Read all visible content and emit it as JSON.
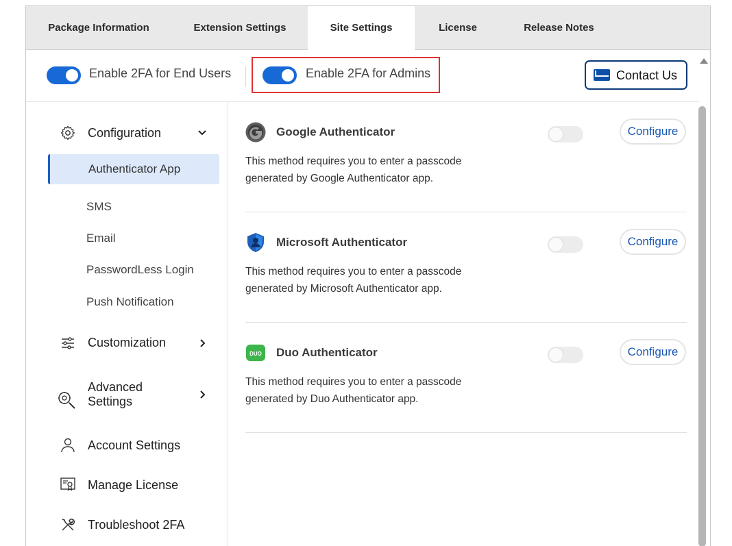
{
  "tabs": [
    {
      "label": "Package Information",
      "active": false
    },
    {
      "label": "Extension Settings",
      "active": false
    },
    {
      "label": "Site Settings",
      "active": true
    },
    {
      "label": "License",
      "active": false
    },
    {
      "label": "Release Notes",
      "active": false
    }
  ],
  "toggles": {
    "end_users": {
      "label": "Enable 2FA for End Users",
      "on": true
    },
    "admins": {
      "label": "Enable 2FA for Admins",
      "on": true
    }
  },
  "contact": {
    "label": "Contact Us",
    "icon": "mail-icon"
  },
  "sidebar": {
    "configuration": {
      "label": "Configuration",
      "icon": "gear-icon",
      "expanded": true
    },
    "sub_items": [
      {
        "label": "Authenticator App",
        "active": true
      },
      {
        "label": "SMS"
      },
      {
        "label": "Email"
      },
      {
        "label": "PasswordLess Login"
      },
      {
        "label": "Push Notification"
      }
    ],
    "customization": {
      "label": "Customization",
      "icon": "sliders-icon"
    },
    "advanced": {
      "label_line1": "Advanced",
      "label_line2": "Settings",
      "icon": "search-gear-icon"
    },
    "account": {
      "label": "Account Settings",
      "icon": "user-icon"
    },
    "license": {
      "label": "Manage License",
      "icon": "certificate-icon"
    },
    "troubleshoot": {
      "label": "Troubleshoot 2FA",
      "icon": "tools-icon"
    }
  },
  "methods": [
    {
      "title": "Google Authenticator",
      "desc_line1": "This method requires you to enter a passcode",
      "desc_line2": "generated by Google Authenticator app.",
      "enabled": false,
      "button": "Configure",
      "icon": "google-authenticator-icon"
    },
    {
      "title": "Microsoft Authenticator",
      "desc_line1": "This method requires you to enter a passcode",
      "desc_line2": "generated by Microsoft Authenticator app.",
      "enabled": false,
      "button": "Configure",
      "icon": "microsoft-authenticator-icon"
    },
    {
      "title": "Duo Authenticator",
      "desc_line1": "This method requires you to enter a passcode",
      "desc_line2": "generated by Duo Authenticator app.",
      "enabled": false,
      "button": "Configure",
      "icon": "duo-icon",
      "icon_text": "DUO"
    }
  ],
  "colors": {
    "accent": "#1769d6",
    "highlight_border": "#e03131",
    "active_nav_bg": "#dde9fb",
    "link": "#1b57b3"
  }
}
